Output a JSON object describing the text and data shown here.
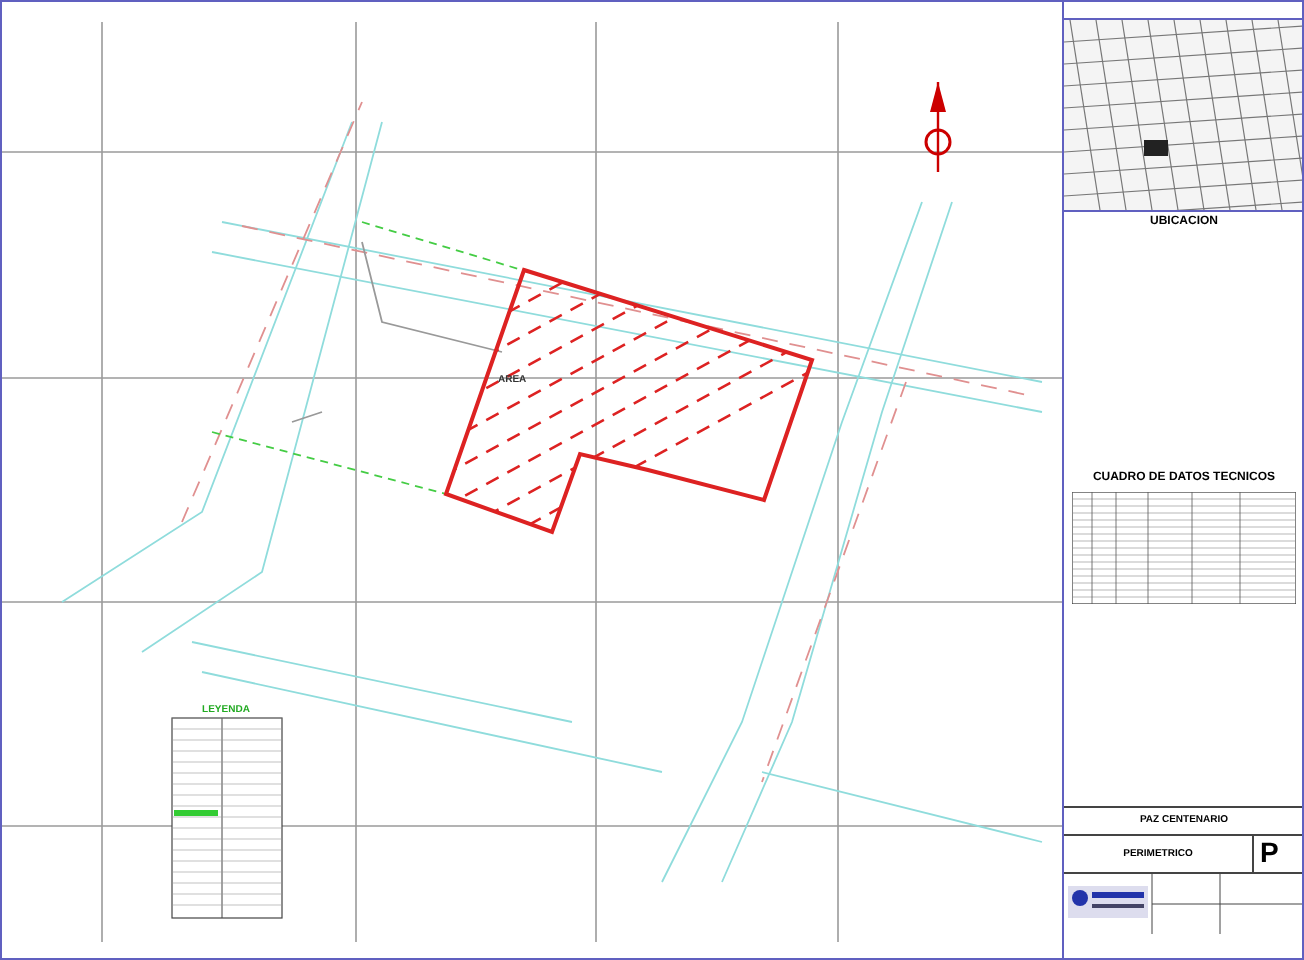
{
  "plan": {
    "area_label": "AREA",
    "legend_title": "LEYENDA"
  },
  "location_map": {
    "label": "UBICACION"
  },
  "data_table": {
    "title": "CUADRO DE DATOS TECNICOS"
  },
  "title_block": {
    "project": "PAZ CENTENARIO",
    "drawing": "PERIMETRICO",
    "sheet": "P"
  }
}
